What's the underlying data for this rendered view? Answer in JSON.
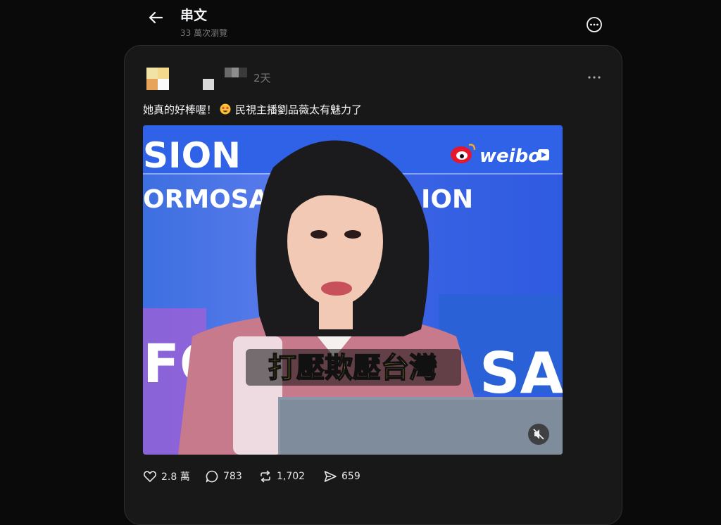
{
  "header": {
    "title": "串文",
    "subtitle": "33 萬次瀏覽"
  },
  "post": {
    "time": "2天",
    "text": "她真的好棒喔！",
    "text_after_emoji": "民視主播劉品薇太有魅力了",
    "emoji_icon": "star-struck-emoji",
    "video": {
      "bg_text_top": "SION",
      "bg_text_mid": "ORMOSA",
      "bg_text_mid2": "ION",
      "bg_text_bottom_left": "FO",
      "bg_text_bottom_right": "SA",
      "watermark": "weibo",
      "caption": "打壓欺壓台灣",
      "caption_color": "#f7e832"
    },
    "stats": {
      "likes": "2.8 萬",
      "replies": "783",
      "reposts": "1,702",
      "shares": "659"
    }
  },
  "colors": {
    "background": "#0a0a0a",
    "card": "#181818",
    "muted": "#777777"
  }
}
